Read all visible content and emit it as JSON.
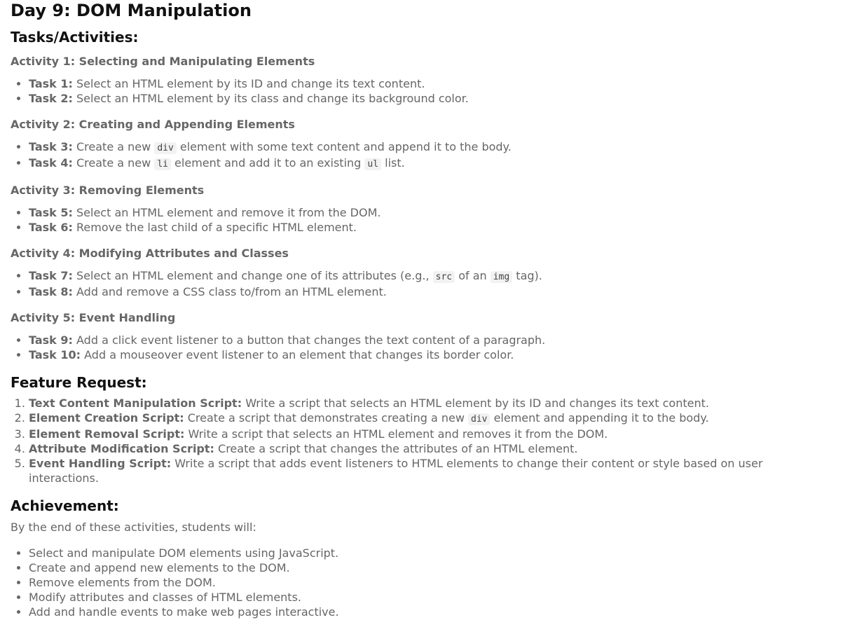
{
  "title": "Day 9: DOM Manipulation",
  "tasks_heading": "Tasks/Activities:",
  "activities": [
    {
      "heading": "Activity 1: Selecting and Manipulating Elements",
      "tasks": [
        {
          "label": "Task 1:",
          "parts": [
            " Select an HTML element by its ID and change its text content."
          ]
        },
        {
          "label": "Task 2:",
          "parts": [
            " Select an HTML element by its class and change its background color."
          ]
        }
      ]
    },
    {
      "heading": "Activity 2: Creating and Appending Elements",
      "tasks": [
        {
          "label": "Task 3:",
          "parts": [
            " Create a new ",
            {
              "code": "div"
            },
            " element with some text content and append it to the body."
          ]
        },
        {
          "label": "Task 4:",
          "parts": [
            " Create a new ",
            {
              "code": "li"
            },
            " element and add it to an existing ",
            {
              "code": "ul"
            },
            " list."
          ]
        }
      ]
    },
    {
      "heading": "Activity 3: Removing Elements",
      "tasks": [
        {
          "label": "Task 5:",
          "parts": [
            " Select an HTML element and remove it from the DOM."
          ]
        },
        {
          "label": "Task 6:",
          "parts": [
            " Remove the last child of a specific HTML element."
          ]
        }
      ]
    },
    {
      "heading": "Activity 4: Modifying Attributes and Classes",
      "tasks": [
        {
          "label": "Task 7:",
          "parts": [
            " Select an HTML element and change one of its attributes (e.g., ",
            {
              "code": "src"
            },
            " of an ",
            {
              "code": "img"
            },
            " tag)."
          ]
        },
        {
          "label": "Task 8:",
          "parts": [
            " Add and remove a CSS class to/from an HTML element."
          ]
        }
      ]
    },
    {
      "heading": "Activity 5: Event Handling",
      "tasks": [
        {
          "label": "Task 9:",
          "parts": [
            " Add a click event listener to a button that changes the text content of a paragraph."
          ]
        },
        {
          "label": "Task 10:",
          "parts": [
            " Add a mouseover event listener to an element that changes its border color."
          ]
        }
      ]
    }
  ],
  "feature_heading": "Feature Request:",
  "features": [
    {
      "label": "Text Content Manipulation Script:",
      "parts": [
        " Write a script that selects an HTML element by its ID and changes its text content."
      ]
    },
    {
      "label": "Element Creation Script:",
      "parts": [
        " Create a script that demonstrates creating a new ",
        {
          "code": "div"
        },
        " element and appending it to the body."
      ]
    },
    {
      "label": "Element Removal Script:",
      "parts": [
        " Write a script that selects an HTML element and removes it from the DOM."
      ]
    },
    {
      "label": "Attribute Modification Script:",
      "parts": [
        " Create a script that changes the attributes of an HTML element."
      ]
    },
    {
      "label": "Event Handling Script:",
      "parts": [
        " Write a script that adds event listeners to HTML elements to change their content or style based on user interactions."
      ]
    }
  ],
  "achievement_heading": "Achievement:",
  "achievement_intro": "By the end of these activities, students will:",
  "achievements": [
    "Select and manipulate DOM elements using JavaScript.",
    "Create and append new elements to the DOM.",
    "Remove elements from the DOM.",
    "Modify attributes and classes of HTML elements.",
    "Add and handle events to make web pages interactive."
  ]
}
